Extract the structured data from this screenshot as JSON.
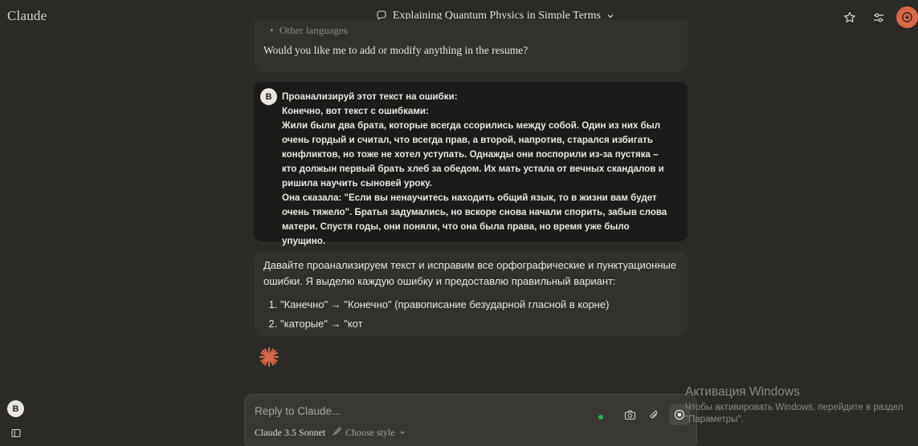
{
  "app": {
    "name": "Claude"
  },
  "header": {
    "title": "Explaining Quantum Physics in Simple Terms"
  },
  "prev_message": {
    "list_item": "Other languages",
    "question": "Would you like me to add or modify anything in the resume?"
  },
  "user_message": {
    "avatar": "B",
    "lines": [
      "Проанализируй этот текст на ошибки:",
      "Конечно, вот текст с ошибками:",
      "Жили были два брата, которые всегда ссорились между собой. Один из них был очень гордый и считал, что всегда прав, а второй, напротив, старался избигать конфликтов, но тоже не хотел уступать. Однажды они поспорили из-за пустяка – кто должын первый брать хлеб за обедом. Их мать устала от вечных скандалов и ришила научить сыновей уроку.",
      "Она сказала: \"Если вы ненаучитесь находить общий язык, то в жизни вам будет очень тяжело\". Братья задумались, но вскоре снова начали спорить, забыв слова матери. Спустя годы, они поняли, что она была права, но время уже было упущино."
    ]
  },
  "assistant_message": {
    "intro": "Давайте проанализируем текст и исправим все орфографические и пунктуационные ошибки. Я выделю каждую ошибку и предоставлю правильный вариант:",
    "items": [
      "\"Канечно\" → \"Конечно\" (правописание безударной гласной в корне)",
      "\"каторые\" → \"кот"
    ]
  },
  "sidebar": {
    "user_initial": "B"
  },
  "composer": {
    "placeholder": "Reply to Claude...",
    "model": "Claude 3.5 Sonnet",
    "style_label": "Choose style"
  },
  "watermark": {
    "title": "Активация Windows",
    "text": "Чтобы активировать Windows, перейдите в раздел \"Параметры\"."
  },
  "colors": {
    "background": "#2b2a27",
    "accent": "#d9684b",
    "user_bubble": "#1c1b19",
    "assistant_bubble": "#32312d"
  }
}
